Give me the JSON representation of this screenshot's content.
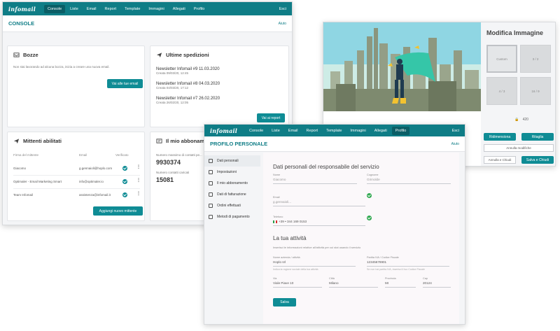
{
  "console": {
    "logo": "infomail",
    "nav": [
      "Console",
      "Liste",
      "Email",
      "Report",
      "Template",
      "Immagini",
      "Allegati",
      "Profilo"
    ],
    "nav_active": "Console",
    "logout": "Esci",
    "title": "CONSOLE",
    "help": "Aiuto",
    "drafts": {
      "title": "Bozze",
      "empty_text": "Non stai lavorando ad alcuna bozza, inizia a creare una nuova email.",
      "button": "Vai alle tue email"
    },
    "last_sent": {
      "title": "Ultime spedizioni",
      "items": [
        {
          "name": "Newsletter Infomail #9 11.03.2020",
          "created": "Creata 09/03/20, 12:45"
        },
        {
          "name": "Newsletter Infomail #8 04.03.2020",
          "created": "Creata 04/03/20, 17:12"
        },
        {
          "name": "Newsletter Infomail #7 26.02.2020",
          "created": "Creata 26/02/20, 12:05"
        }
      ],
      "button": "Vai ai report"
    },
    "senders": {
      "title": "Mittenti abilitati",
      "col_signature": "Firma del mittente",
      "col_email": "Email",
      "col_verified": "Verificato",
      "rows": [
        {
          "name": "Giacomo",
          "email": "g.gennaioli@hoplo.com"
        },
        {
          "name": "Optimaler - Email Marketing Smart",
          "email": "info@optimaler.io"
        },
        {
          "name": "Team Infomail",
          "email": "assistenza@infomail.it"
        }
      ],
      "button": "Aggiungi nuovo mittente"
    },
    "subscription": {
      "title": "Il mio abbonamento",
      "max_label": "Numero massimo di contatti pe...",
      "max_value": "9930374",
      "loaded_label": "Numero contatti caricati",
      "loaded_value": "15081"
    }
  },
  "editor": {
    "title": "Modifica Immagine",
    "ratios": [
      "Custom",
      "3 / 2",
      "4 / 3",
      "16 / 9"
    ],
    "lock_value": "420",
    "btn_rotate": "Ridimensiona",
    "btn_crop": "Ritaglia",
    "btn_cancel_edit": "Annulla modifiche",
    "btn_cancel_close": "Annulla e Chiudi",
    "btn_save_close": "Salva e Chiudi"
  },
  "profile": {
    "logo": "infomail",
    "nav": [
      "Console",
      "Liste",
      "Email",
      "Report",
      "Template",
      "Immagini",
      "Allegati",
      "Profilo"
    ],
    "nav_active": "Profilo",
    "logout": "Esci",
    "title": "PROFILO PERSONALE",
    "help": "Aiuto",
    "side": [
      "Dati personali",
      "Impostazioni",
      "Il mio abbonamento",
      "Dati di fatturazione",
      "Ordini effettuati",
      "Metodi di pagamento"
    ],
    "section1": "Dati personali del responsabile del servizio",
    "name_label": "Nome",
    "name_value": "Giacomo",
    "surname_label": "Cognome",
    "surname_value": "Grimolde",
    "email_label": "Email",
    "email_value": "g.gennaioli...",
    "phone_label": "Telefono",
    "phone_value": "+39 • 344 169 0153",
    "section2": "La tua attività",
    "activity_hint": "Inserisci le informazioni relative all'attività per cui stai usando il servizio",
    "company_label": "Nome azienda / attività",
    "company_value": "Hoplo srl",
    "company_help": "Indica la ragione sociale della tua attività",
    "vat_label": "Partita IVA / Codice Fiscale",
    "vat_value": "12345678901",
    "vat_help": "Se non hai partita IVA, inserisci il tuo Codice Fiscale",
    "address_label": "Via",
    "address_value": "Viale Piave 10",
    "city_label": "Città",
    "city_value": "Milano",
    "province_label": "Provincia",
    "province_value": "MI",
    "zip_label": "Cap",
    "zip_value": "20124",
    "save": "Salva"
  }
}
